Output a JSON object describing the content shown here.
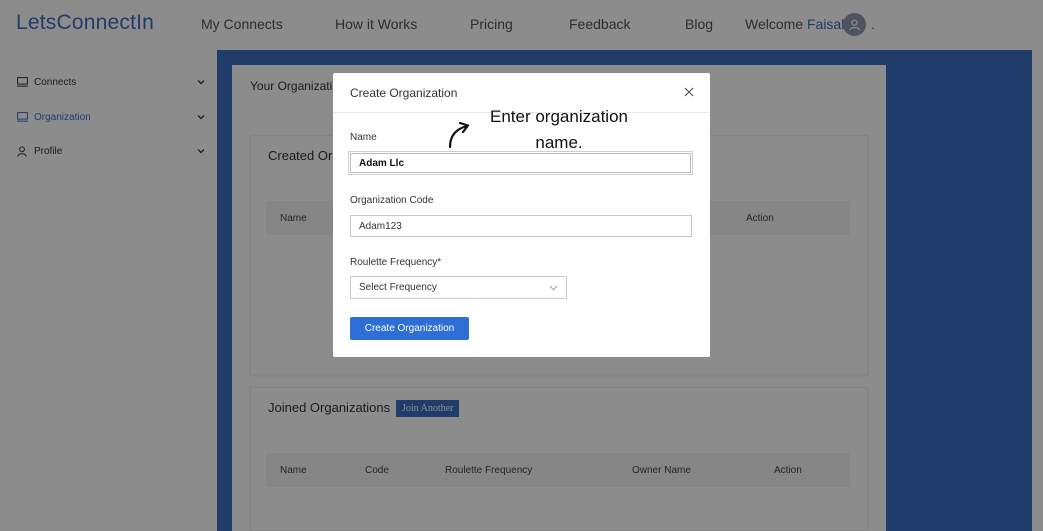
{
  "brand": "LetsConnectIn",
  "nav": {
    "my_connects": "My Connects",
    "how_it_works": "How it Works",
    "pricing": "Pricing",
    "feedback": "Feedback",
    "blog": "Blog",
    "welcome": "Welcome",
    "user_name": "Faisal",
    "trailing": "."
  },
  "sidebar": {
    "items": [
      {
        "label": "Connects",
        "icon": "monitor-icon"
      },
      {
        "label": "Organization",
        "icon": "monitor-icon"
      },
      {
        "label": "Profile",
        "icon": "user-icon"
      }
    ]
  },
  "main": {
    "page_title": "Your Organizati",
    "created_card": {
      "title": "Created Or",
      "headers": [
        "Name",
        "Action"
      ]
    },
    "joined_card": {
      "title": "Joined Organizations",
      "join_button": "Join Another",
      "headers": [
        "Name",
        "Code",
        "Roulette Frequency",
        "Owner Name",
        "Action"
      ]
    }
  },
  "modal": {
    "title": "Create Organization",
    "name_label": "Name",
    "name_value": "Adam Llc",
    "code_label": "Organization Code",
    "code_value": "Adam123",
    "freq_label": "Roulette Frequency*",
    "freq_value": "Select Frequency",
    "submit_label": "Create Organization"
  },
  "annotation": {
    "line1": "Enter organization",
    "line2": "name."
  },
  "colors": {
    "brand": "#3a6ec2",
    "button": "#2d6fd6"
  }
}
